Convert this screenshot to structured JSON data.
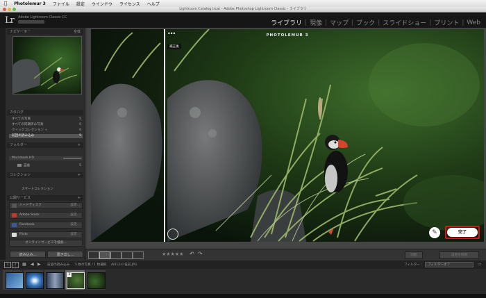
{
  "menubar": {
    "apple": "",
    "app": "Photolemur 3",
    "items": [
      "ファイル",
      "設定",
      "ウインドウ",
      "ライセンス",
      "ヘルプ"
    ]
  },
  "window": {
    "title": "Lightroom Catalog.lrcat - Adobe Photoshop Lightroom Classic - ライブラリ"
  },
  "identity": {
    "logo": "Lr",
    "line1": "Adobe Lightroom Classic CC",
    "line2": ""
  },
  "modules": [
    "ライブラリ",
    "現像",
    "マップ",
    "ブック",
    "スライドショー",
    "プリント",
    "Web"
  ],
  "left_panel": {
    "navigator_title": "ナビゲーター",
    "navigator_options": "全体",
    "catalog_title": "カタログ",
    "catalog_rows": [
      {
        "label": "すべての写真",
        "count": "5"
      },
      {
        "label": "すべての同期済み写真",
        "count": "0"
      },
      {
        "label": "クイックコレクション +",
        "count": "0"
      },
      {
        "label": "前回の読み込み",
        "count": "5"
      }
    ],
    "folders_title": "フォルダー",
    "volume": "Macintosh HD",
    "volume_info": "",
    "folder_label": "画像",
    "folder_count": "5",
    "collections_title": "コレクション",
    "smart_collection": "スマートコレクション",
    "publish_title": "公開サービス",
    "services": [
      {
        "label": "ハードディスク",
        "btn": "設定...",
        "color": "#555555"
      },
      {
        "label": "Adobe Stock",
        "btn": "設定...",
        "color": "#c0392b"
      },
      {
        "label": "Facebook",
        "btn": "設定...",
        "color": "#3b5998"
      },
      {
        "label": "Flickr",
        "btn": "設定...",
        "color": "#dddddd"
      }
    ],
    "more_services": "オンラインサービスを検索...",
    "import_button": "読み込み...",
    "export_button": "書き出し..."
  },
  "photolemur": {
    "brand": "PHOTOLEMUR 3",
    "compare_label": "補正後",
    "done_button": "完了",
    "dots": "•••"
  },
  "filmstrip": {
    "page_a": "1",
    "page_b": "2",
    "source": "前回の読み込み",
    "info": "5 枚の写真 / 1 枚選択",
    "filename": "/6012-0 名前.JPG",
    "filter_label": "フィルター :",
    "filter_value": "フィルターオフ",
    "thumb_badge": "2"
  },
  "right_buttons": {
    "sync": "同期",
    "sync_settings": "設定を同期"
  }
}
